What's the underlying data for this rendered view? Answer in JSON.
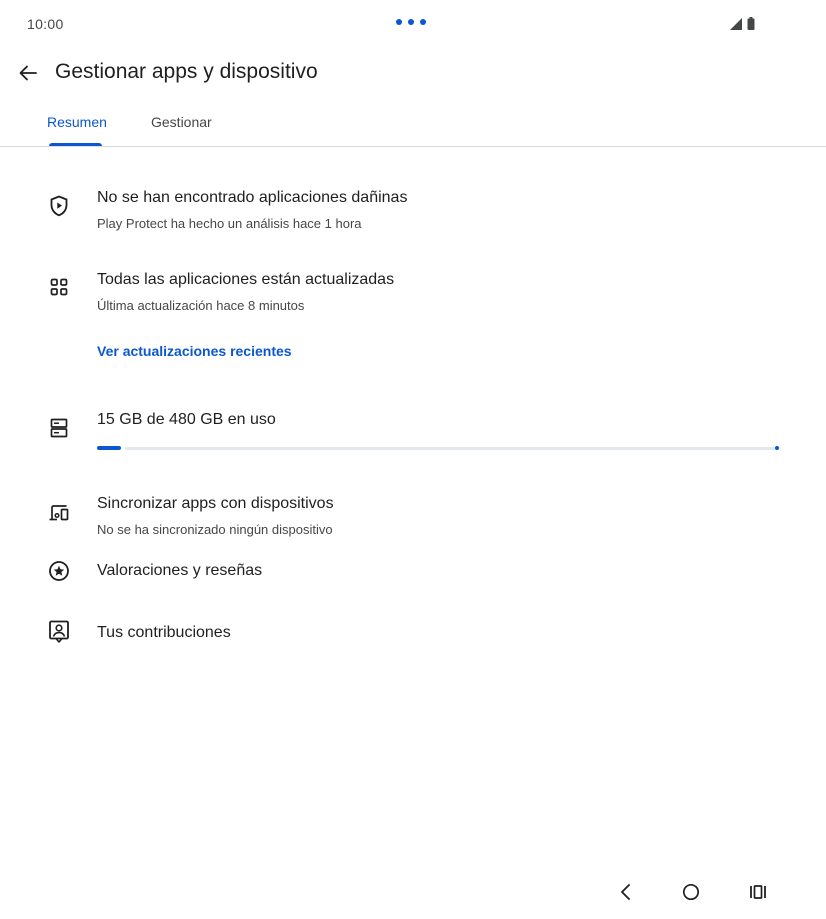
{
  "status_bar": {
    "time": "10:00"
  },
  "app_bar": {
    "title": "Gestionar apps y dispositivo"
  },
  "tabs": [
    {
      "label": "Resumen",
      "selected": true
    },
    {
      "label": "Gestionar",
      "selected": false
    }
  ],
  "summary": {
    "protect": {
      "title": "No se han encontrado aplicaciones dañinas",
      "subtitle": "Play Protect ha hecho un análisis hace 1 hora"
    },
    "updates": {
      "title": "Todas las aplicaciones están actualizadas",
      "subtitle": "Última actualización hace 8 minutos",
      "link": "Ver actualizaciones recientes"
    },
    "storage": {
      "title": "15 GB de 480 GB en uso",
      "used_fraction": 0.031
    },
    "sync": {
      "title": "Sincronizar apps con dispositivos",
      "subtitle": "No se ha sincronizado ningún dispositivo"
    },
    "ratings": {
      "title": "Valoraciones y reseñas"
    },
    "contributions": {
      "title": "Tus contribuciones"
    }
  },
  "colors": {
    "accent": "#0b57d0",
    "text_primary": "#1f1f1f",
    "text_secondary": "#444746",
    "divider": "#dadce0"
  },
  "icons": {
    "back": "arrow-back-icon",
    "protect": "shield-play-icon",
    "updates": "apps-grid-icon",
    "storage": "storage-icon",
    "sync": "devices-icon",
    "ratings": "star-circle-icon",
    "contributions": "account-box-icon"
  }
}
